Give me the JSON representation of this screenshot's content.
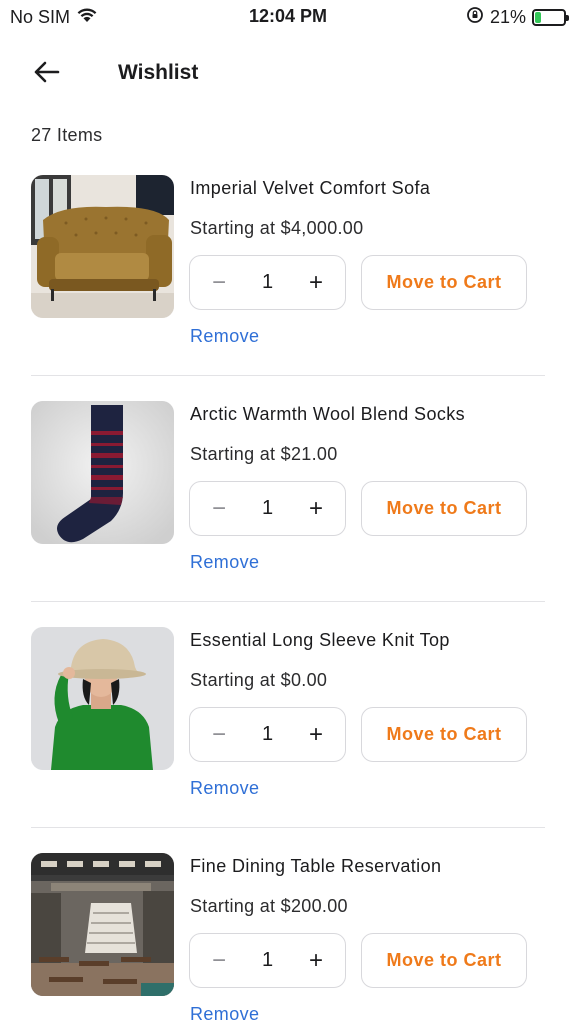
{
  "status_bar": {
    "carrier": "No SIM",
    "time": "12:04 PM",
    "battery_percent": "21%",
    "battery_level": 0.21,
    "icons": [
      "wifi-icon",
      "orientation-lock-icon",
      "battery-charging-icon"
    ]
  },
  "header": {
    "title": "Wishlist",
    "back_icon": "arrow-left-icon"
  },
  "item_count": "27 Items",
  "colors": {
    "accent": "#ef7a1a",
    "link": "#2f6fd6",
    "border": "#d8d8dc",
    "battery": "#34c759"
  },
  "items": [
    {
      "name": "Imperial Velvet Comfort Sofa",
      "price": "Starting at $4,000.00",
      "quantity": "1",
      "minus": "−",
      "plus": "+",
      "move_label": "Move to Cart",
      "remove_label": "Remove",
      "image": "velvet-sofa-photo"
    },
    {
      "name": "Arctic Warmth Wool Blend Socks",
      "price": "Starting at $21.00",
      "quantity": "1",
      "minus": "−",
      "plus": "+",
      "move_label": "Move to Cart",
      "remove_label": "Remove",
      "image": "wool-sock-photo"
    },
    {
      "name": "Essential Long Sleeve Knit Top",
      "price": "Starting at $0.00",
      "quantity": "1",
      "minus": "−",
      "plus": "+",
      "move_label": "Move to Cart",
      "remove_label": "Remove",
      "image": "green-knit-top-photo"
    },
    {
      "name": "Fine Dining Table Reservation",
      "price": "Starting at $200.00",
      "quantity": "1",
      "minus": "−",
      "plus": "+",
      "move_label": "Move to Cart",
      "remove_label": "Remove",
      "image": "restaurant-interior-photo"
    }
  ]
}
